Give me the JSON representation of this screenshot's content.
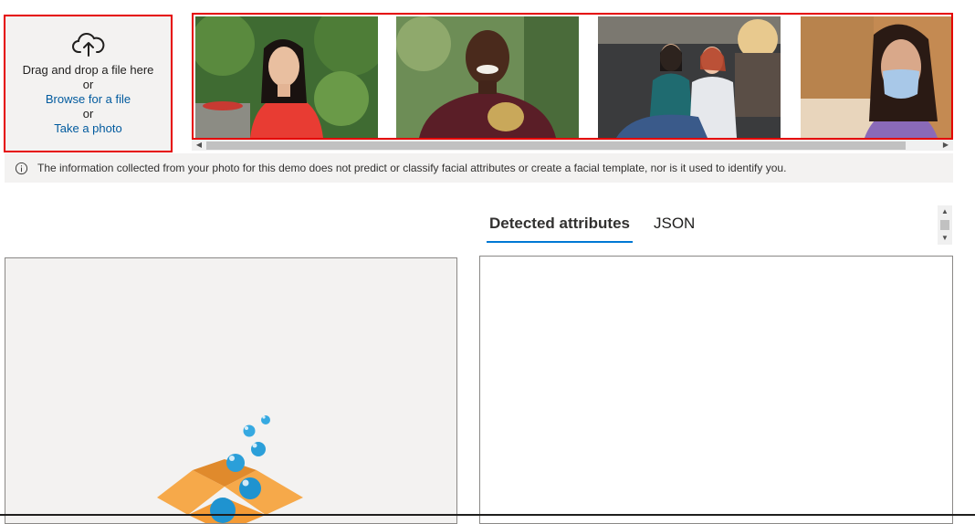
{
  "upload": {
    "drag_text": "Drag and drop a file here",
    "or_1": "or",
    "browse_label": "Browse for a file",
    "or_2": "or",
    "photo_label": "Take a photo",
    "icon": "cloud-upload-icon"
  },
  "gallery": {
    "items": [
      {
        "name": "sample-photo-1",
        "desc": "woman in red top outdoors"
      },
      {
        "name": "sample-photo-2",
        "desc": "smiling man holding hat"
      },
      {
        "name": "sample-photo-3",
        "desc": "two women in workshop"
      },
      {
        "name": "sample-photo-4",
        "desc": "woman wearing face mask"
      }
    ]
  },
  "info": {
    "icon": "info-icon",
    "text": "The information collected from your photo for this demo does not predict or classify facial attributes or create a facial template, nor is it used to identify you."
  },
  "tabs": [
    {
      "label": "Detected attributes",
      "active": true
    },
    {
      "label": "JSON",
      "active": false
    }
  ],
  "colors": {
    "accent": "#0078d4",
    "highlight_border": "#e50000",
    "link": "#005a9e",
    "panel_bg": "#f3f2f1"
  }
}
